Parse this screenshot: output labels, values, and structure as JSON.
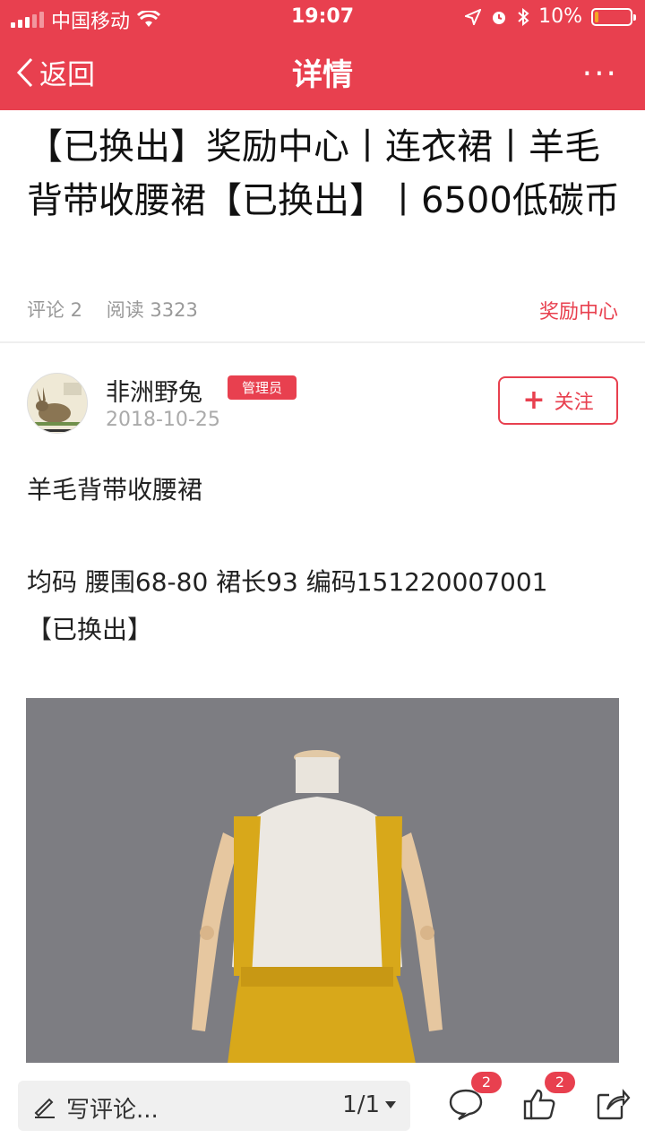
{
  "status_bar": {
    "carrier": "中国移动",
    "time": "19:07",
    "battery": "10%",
    "battery_level": 0.1
  },
  "nav": {
    "back_label": "返回",
    "title": "详情",
    "more_label": "···"
  },
  "article": {
    "title": "【已换出】奖励中心丨连衣裙丨羊毛背带收腰裙【已换出】丨6500低碳币",
    "comments_label": "评论 2",
    "reads_label": "阅读 3323",
    "category": "奖励中心"
  },
  "author": {
    "name": "非洲野兔",
    "badge": "管理员",
    "date": "2018-10-25",
    "follow_label": "关注"
  },
  "body": {
    "line1": "羊毛背带收腰裙",
    "line2": "均码 腰围68-80  裙长93  编码151220007001",
    "line3": "【已换出】"
  },
  "bottom_bar": {
    "comment_placeholder": "写评论...",
    "pager": "1/1",
    "comment_count": "2",
    "like_count": "2"
  },
  "colors": {
    "accent": "#e8404f",
    "photo_bg": "#7d7d82",
    "skirt": "#d8a81a"
  },
  "icons": [
    "signal-icon",
    "wifi-icon",
    "location-icon",
    "alarm-icon",
    "bluetooth-icon",
    "battery-icon",
    "back-chevron-icon",
    "more-icon",
    "plus-icon",
    "pen-icon",
    "caret-down-icon",
    "comment-icon",
    "like-icon",
    "share-icon"
  ]
}
